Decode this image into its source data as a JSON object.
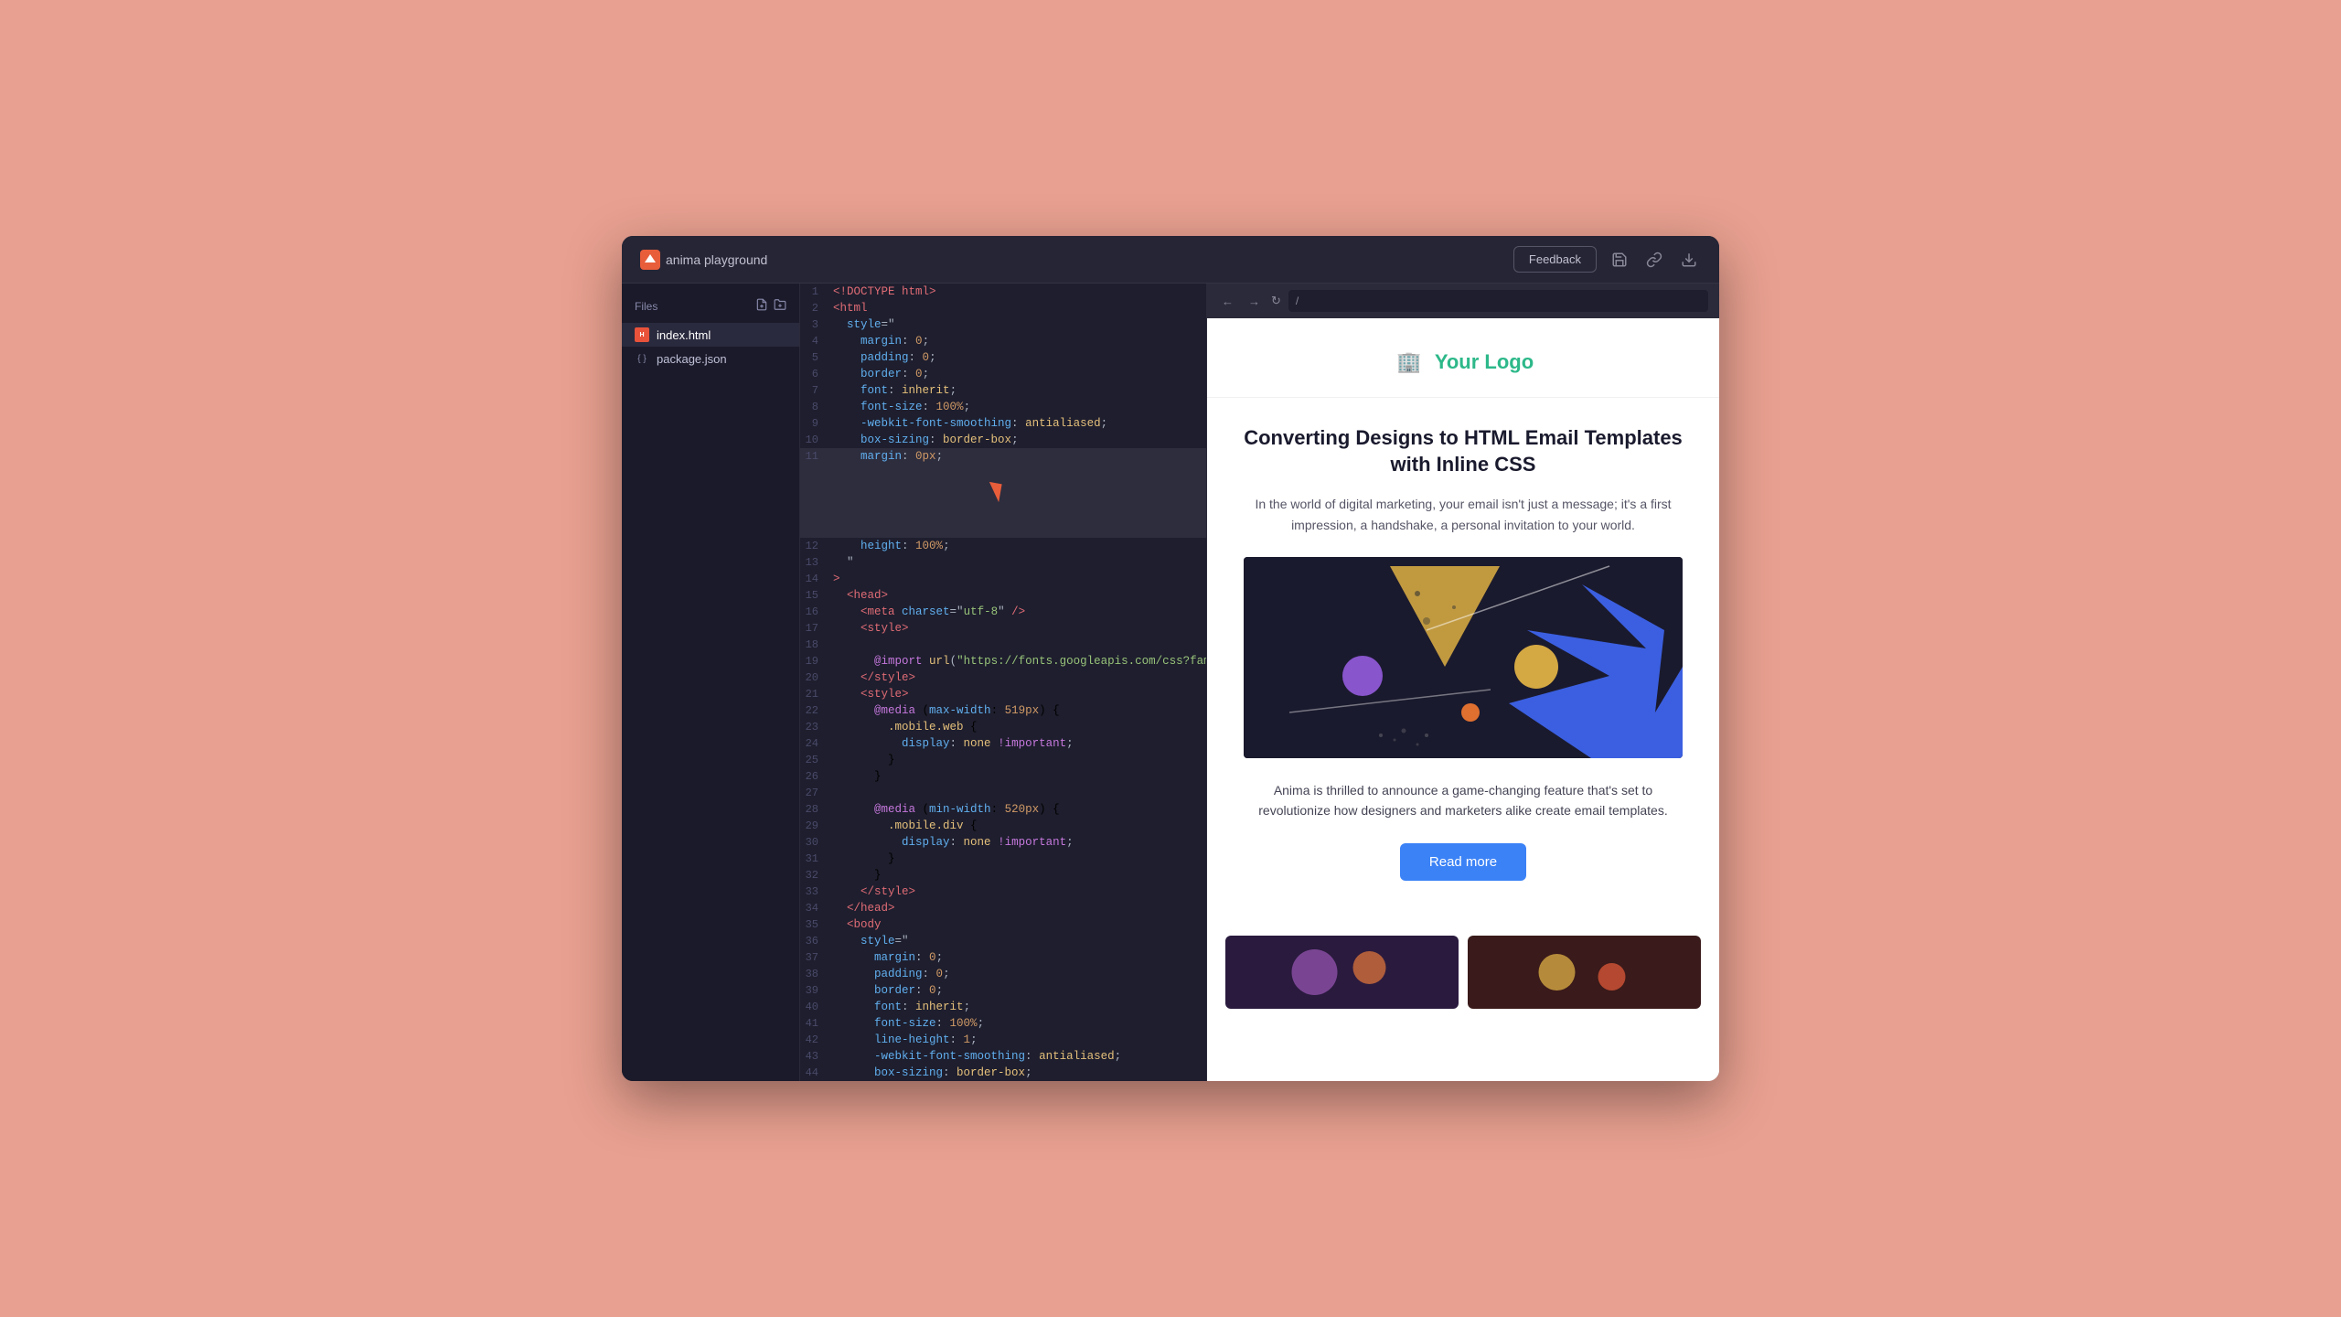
{
  "titleBar": {
    "appName": "anima playground",
    "feedbackLabel": "Feedback",
    "urlPath": "/"
  },
  "sidebar": {
    "title": "Files",
    "files": [
      {
        "name": "index.html",
        "type": "html",
        "active": true
      },
      {
        "name": "package.json",
        "type": "json",
        "active": false
      }
    ]
  },
  "codeLines": [
    {
      "num": 1,
      "content": "<!DOCTYPE html>"
    },
    {
      "num": 2,
      "content": "<html"
    },
    {
      "num": 3,
      "content": "  style=\""
    },
    {
      "num": 4,
      "content": "    margin: 0;"
    },
    {
      "num": 5,
      "content": "    padding: 0;"
    },
    {
      "num": 6,
      "content": "    border: 0;"
    },
    {
      "num": 7,
      "content": "    font: inherit;"
    },
    {
      "num": 8,
      "content": "    font-size: 100%;"
    },
    {
      "num": 9,
      "content": "    -webkit-font-smoothing: antialiased;"
    },
    {
      "num": 10,
      "content": "    box-sizing: border-box;"
    },
    {
      "num": 11,
      "content": "    margin: 0px;",
      "highlighted": true
    },
    {
      "num": 12,
      "content": "    height: 100%;"
    },
    {
      "num": 13,
      "content": "  \""
    },
    {
      "num": 14,
      "content": ">"
    },
    {
      "num": 15,
      "content": "  <head>"
    },
    {
      "num": 16,
      "content": "    <meta charset=\"utf-8\" />"
    },
    {
      "num": 17,
      "content": "    <style>"
    },
    {
      "num": 18,
      "content": ""
    },
    {
      "num": 19,
      "content": "      @import url(\"https://fonts.googleapis.com/css?family=DM+Sans"
    },
    {
      "num": 20,
      "content": "    </style>"
    },
    {
      "num": 21,
      "content": "    <style>"
    },
    {
      "num": 22,
      "content": "      @media (max-width: 519px) {"
    },
    {
      "num": 23,
      "content": "        .mobile.web {"
    },
    {
      "num": 24,
      "content": "          display: none !important;"
    },
    {
      "num": 25,
      "content": "        }"
    },
    {
      "num": 26,
      "content": "      }"
    },
    {
      "num": 27,
      "content": ""
    },
    {
      "num": 28,
      "content": "      @media (min-width: 520px) {"
    },
    {
      "num": 29,
      "content": "        .mobile.div {"
    },
    {
      "num": 30,
      "content": "          display: none !important;"
    },
    {
      "num": 31,
      "content": "        }"
    },
    {
      "num": 32,
      "content": "      }"
    },
    {
      "num": 33,
      "content": "    </style>"
    },
    {
      "num": 34,
      "content": "  </head>"
    },
    {
      "num": 35,
      "content": "  <body"
    },
    {
      "num": 36,
      "content": "    style=\""
    },
    {
      "num": 37,
      "content": "      margin: 0;"
    },
    {
      "num": 38,
      "content": "      padding: 0;"
    },
    {
      "num": 39,
      "content": "      border: 0;"
    },
    {
      "num": 40,
      "content": "      font: inherit;"
    },
    {
      "num": 41,
      "content": "      font-size: 100%;"
    },
    {
      "num": 42,
      "content": "      line-height: 1;"
    },
    {
      "num": 43,
      "content": "      -webkit-font-smoothing: antialiased;"
    },
    {
      "num": 44,
      "content": "      box-sizing: border-box;"
    }
  ],
  "emailPreview": {
    "logoText": "Your Logo",
    "logoEmoji": "🏢",
    "title": "Converting Designs to HTML Email Templates with Inline CSS",
    "subtitle": "In the world of digital marketing, your email isn't just a message; it's a first impression, a handshake, a personal invitation to your world.",
    "description": "Anima is thrilled to announce a game-changing feature that's set to revolutionize how designers and marketers alike create email templates.",
    "readMoreLabel": "Read more"
  },
  "colors": {
    "accent": "#3b82f6",
    "logoColor": "#2db88a",
    "editorBg": "#1e1e2e",
    "sidebarBg": "#1a1a2a",
    "titleBarBg": "#252535"
  }
}
